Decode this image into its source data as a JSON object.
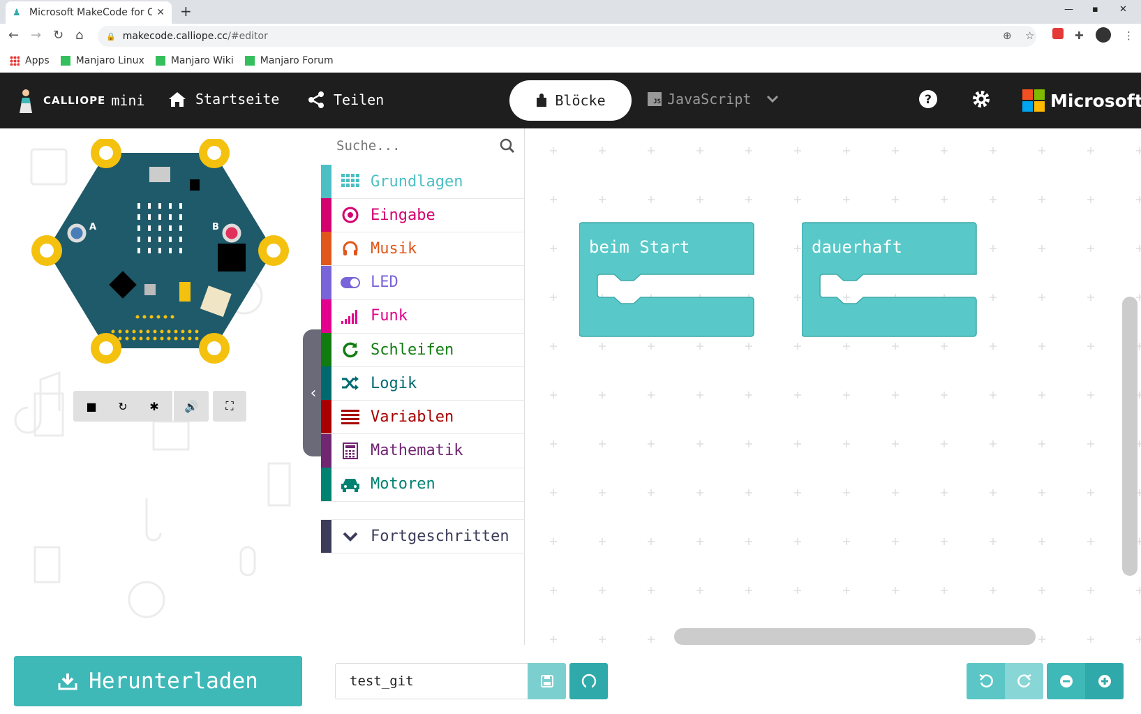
{
  "browser": {
    "tab_title": "Microsoft MakeCode for Calliope",
    "url_host": "makecode.calliope.cc",
    "url_path": "/#editor",
    "bookmarks": [
      {
        "label": "Apps"
      },
      {
        "label": "Manjaro Linux"
      },
      {
        "label": "Manjaro Wiki"
      },
      {
        "label": "Manjaro Forum"
      }
    ]
  },
  "header": {
    "brand": "CALLIOPE",
    "brand_suffix": "mini",
    "home_label": "Startseite",
    "share_label": "Teilen",
    "blocks_label": "Blöcke",
    "js_label": "JavaScript",
    "ms_label": "Microsoft"
  },
  "toolbox": {
    "search_placeholder": "Suche...",
    "categories": [
      {
        "label": "Grundlagen",
        "color": "#4cbfc4",
        "icon": "grid-icon"
      },
      {
        "label": "Eingabe",
        "color": "#d4006f",
        "icon": "target-icon"
      },
      {
        "label": "Musik",
        "color": "#e0561b",
        "icon": "headphones-icon"
      },
      {
        "label": "LED",
        "color": "#7a64d9",
        "icon": "toggle-icon"
      },
      {
        "label": "Funk",
        "color": "#e3008c",
        "icon": "signal-icon"
      },
      {
        "label": "Schleifen",
        "color": "#107c10",
        "icon": "refresh-icon"
      },
      {
        "label": "Logik",
        "color": "#006970",
        "icon": "shuffle-icon"
      },
      {
        "label": "Variablen",
        "color": "#a80000",
        "icon": "list-icon"
      },
      {
        "label": "Mathematik",
        "color": "#712672",
        "icon": "calculator-icon"
      },
      {
        "label": "Motoren",
        "color": "#008272",
        "icon": "car-icon"
      }
    ],
    "advanced_label": "Fortgeschritten"
  },
  "workspace": {
    "blocks": [
      {
        "label": "beim Start"
      },
      {
        "label": "dauerhaft"
      }
    ]
  },
  "bottom": {
    "download_label": "Herunterladen",
    "project_name": "test_git"
  },
  "colors": {
    "accent": "#3fb8b8",
    "block": "#58c8c8",
    "header_bg": "#1e1e1e"
  }
}
